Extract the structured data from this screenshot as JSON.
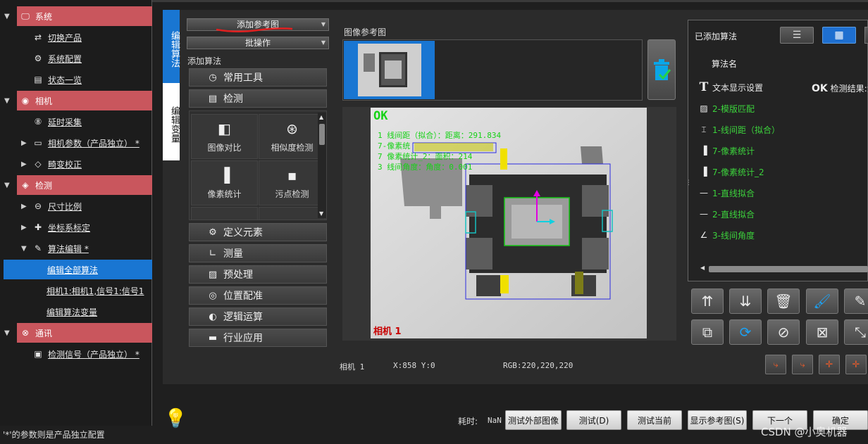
{
  "tree": {
    "items": [
      {
        "label": "系统",
        "icon": "monitor-icon",
        "group": true
      },
      {
        "label": "切换产品",
        "icon": "switch-icon"
      },
      {
        "label": "系统配置",
        "icon": "gear-icon"
      },
      {
        "label": "状态一览",
        "icon": "status-icon"
      },
      {
        "label": "相机",
        "icon": "camera-icon",
        "group": true
      },
      {
        "label": "延时采集",
        "icon": "timer-icon"
      },
      {
        "label": "相机参数（产品独立） *",
        "icon": "camera-param-icon"
      },
      {
        "label": "畸变校正",
        "icon": "distortion-icon"
      },
      {
        "label": "检测",
        "icon": "inspect-icon",
        "group": true
      },
      {
        "label": "尺寸比例",
        "icon": "ruler-icon"
      },
      {
        "label": "坐标系标定",
        "icon": "axis-icon"
      },
      {
        "label": "算法编辑 *",
        "icon": "edit-icon"
      },
      {
        "label": "编辑全部算法",
        "icon": ""
      },
      {
        "label": "相机1:相机1,信号1:信号1",
        "icon": ""
      },
      {
        "label": "编辑算法变量",
        "icon": ""
      },
      {
        "label": "通讯",
        "icon": "network-icon",
        "group": true
      },
      {
        "label": "检测信号（产品独立） *",
        "icon": "signal-icon"
      }
    ],
    "footnote": "'*'的参数则是产品独立配置"
  },
  "side_tabs": [
    "编辑算法",
    "编辑变量"
  ],
  "left_panel": {
    "add_ref_button": "添加参考图",
    "batch_button": "批操作",
    "add_algo_label": "添加算法",
    "categories_top": [
      {
        "label": "常用工具",
        "icon": "clock-icon"
      },
      {
        "label": "检测",
        "icon": "inspect-icon"
      }
    ],
    "grid": [
      {
        "label": "图像对比",
        "icon": "image-compare-icon",
        "glyph": "◧"
      },
      {
        "label": "相似度检测",
        "icon": "similarity-icon",
        "glyph": "⊛"
      },
      {
        "label": "像素统计",
        "icon": "bar-chart-icon",
        "glyph": "▐"
      },
      {
        "label": "污点检测",
        "icon": "stain-icon",
        "glyph": "▪"
      }
    ],
    "categories_bottom": [
      {
        "label": "定义元素",
        "icon": "gear-icon"
      },
      {
        "label": "测量",
        "icon": "measure-icon"
      },
      {
        "label": "预处理",
        "icon": "image-icon"
      },
      {
        "label": "位置配准",
        "icon": "target-icon"
      },
      {
        "label": "逻辑运算",
        "icon": "toggle-icon"
      },
      {
        "label": "行业应用",
        "icon": "briefcase-icon"
      }
    ]
  },
  "image_panel": {
    "ref_label": "图像参考图",
    "ok_text": "OK",
    "overlay_lines": [
      "1 线间距（拟合）：距离：291.834",
      "7-像素统",
      "7 像素统计_2：面积：214",
      "3 线间角度：角度：0.001"
    ],
    "camera_tag": "相机 1",
    "status": {
      "camera": "相机 1",
      "coords": "X:858 Y:0",
      "rgb": "RGB:220,220,220"
    }
  },
  "right_panel": {
    "title": "已添加算法",
    "column": "算法名",
    "result_label": "检测结果:江",
    "algorithms": [
      {
        "label": "文本显示设置",
        "icon": "text-icon",
        "color": "#e6e6e6"
      },
      {
        "label": "2-模版匹配",
        "icon": "match-icon",
        "color": "#3cd23c"
      },
      {
        "label": "1-线间距（拟合）",
        "icon": "line-distance-icon",
        "color": "#3cd23c"
      },
      {
        "label": "7-像素统计",
        "icon": "bar-chart-icon",
        "color": "#3cd23c"
      },
      {
        "label": "7-像素统计_2",
        "icon": "bar-chart-icon",
        "color": "#3cd23c"
      },
      {
        "label": "1-直线拟合",
        "icon": "line-icon",
        "color": "#3cd23c"
      },
      {
        "label": "2-直线拟合",
        "icon": "line-icon",
        "color": "#3cd23c"
      },
      {
        "label": "3-线间角度",
        "icon": "angle-icon",
        "color": "#3cd23c"
      }
    ]
  },
  "bottom": {
    "time_label": "耗时:",
    "time_value": "NaN",
    "buttons": [
      "测试外部图像",
      "测试(D)",
      "测试当前",
      "显示参考图(S)",
      "下一个",
      "确定"
    ]
  },
  "watermark": "CSDN @小奥机器",
  "colors": {
    "accent": "#1976d2",
    "group": "#c9565d",
    "ok": "#3cd23c"
  }
}
